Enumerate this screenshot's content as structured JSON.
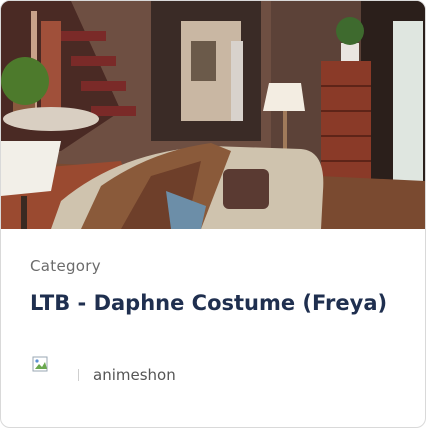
{
  "card": {
    "image_alt": "Living room interior with sofa, throw blankets, lamps and staircase",
    "category_label": "Category",
    "title": "LTB - Daphne Costume (Freya)",
    "author": {
      "name": "animeshon",
      "avatar_icon": "broken-image-icon"
    }
  }
}
